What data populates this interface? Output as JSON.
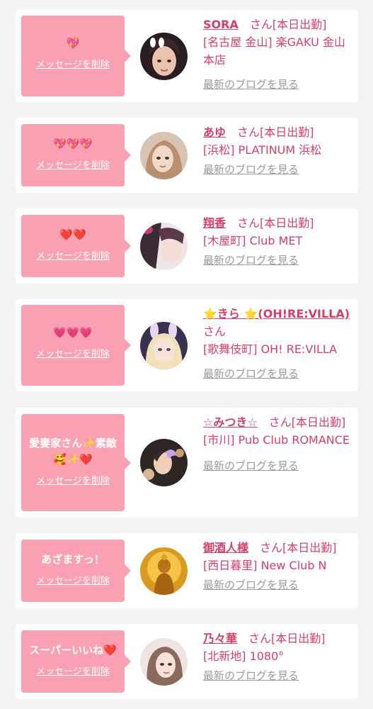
{
  "delete_label": "メッセージを削除",
  "blog_label": "最新のブログを見る",
  "colors": {
    "bubble": "#f9a1b2",
    "accent": "#d43f64",
    "muted": "#9a9a9a",
    "background": "#f3f3f3"
  },
  "cards": [
    {
      "message": "💖",
      "name": "SORA",
      "suffix": "　さん[本日出勤]",
      "store": "[名古屋 金山] 楽GAKU 金山本店",
      "avatar_icon": "person-photo-sora"
    },
    {
      "message": "💖💖💖",
      "name": "あゆ",
      "suffix": "　さん[本日出勤]",
      "store": "[浜松] PLATINUM 浜松",
      "avatar_icon": "person-photo-ayu"
    },
    {
      "message": "❤️❤️",
      "name": "翔香",
      "suffix": "　さん[本日出勤]",
      "store": "[木屋町] Club MET",
      "avatar_icon": "person-photo-shoka"
    },
    {
      "message": "💗💗💗",
      "name": "⭐きら ⭐(OH!RE:VILLA)",
      "suffix": "　さん",
      "store": "[歌舞伎町] OH! RE:VILLA",
      "avatar_icon": "person-photo-kira"
    },
    {
      "message": "愛妻家さん✨素敵\n🥰✨❤️",
      "name": "☆みつき☆",
      "suffix": "　さん[本日出勤]",
      "store": "[市川] Pub Club ROMANCE",
      "avatar_icon": "person-photo-mitsuki"
    },
    {
      "message": "あざますっ！",
      "name": "御酒人様",
      "suffix": "　さん[本日出勤]",
      "store": "[西日暮里] New Club N",
      "avatar_icon": "golden-statue-photo"
    },
    {
      "message": "スーパーいいね❤️",
      "name": "乃々華",
      "suffix": "　さん[本日出勤]",
      "store": "[北新地] 1080°",
      "avatar_icon": "person-photo-nonoka"
    }
  ]
}
